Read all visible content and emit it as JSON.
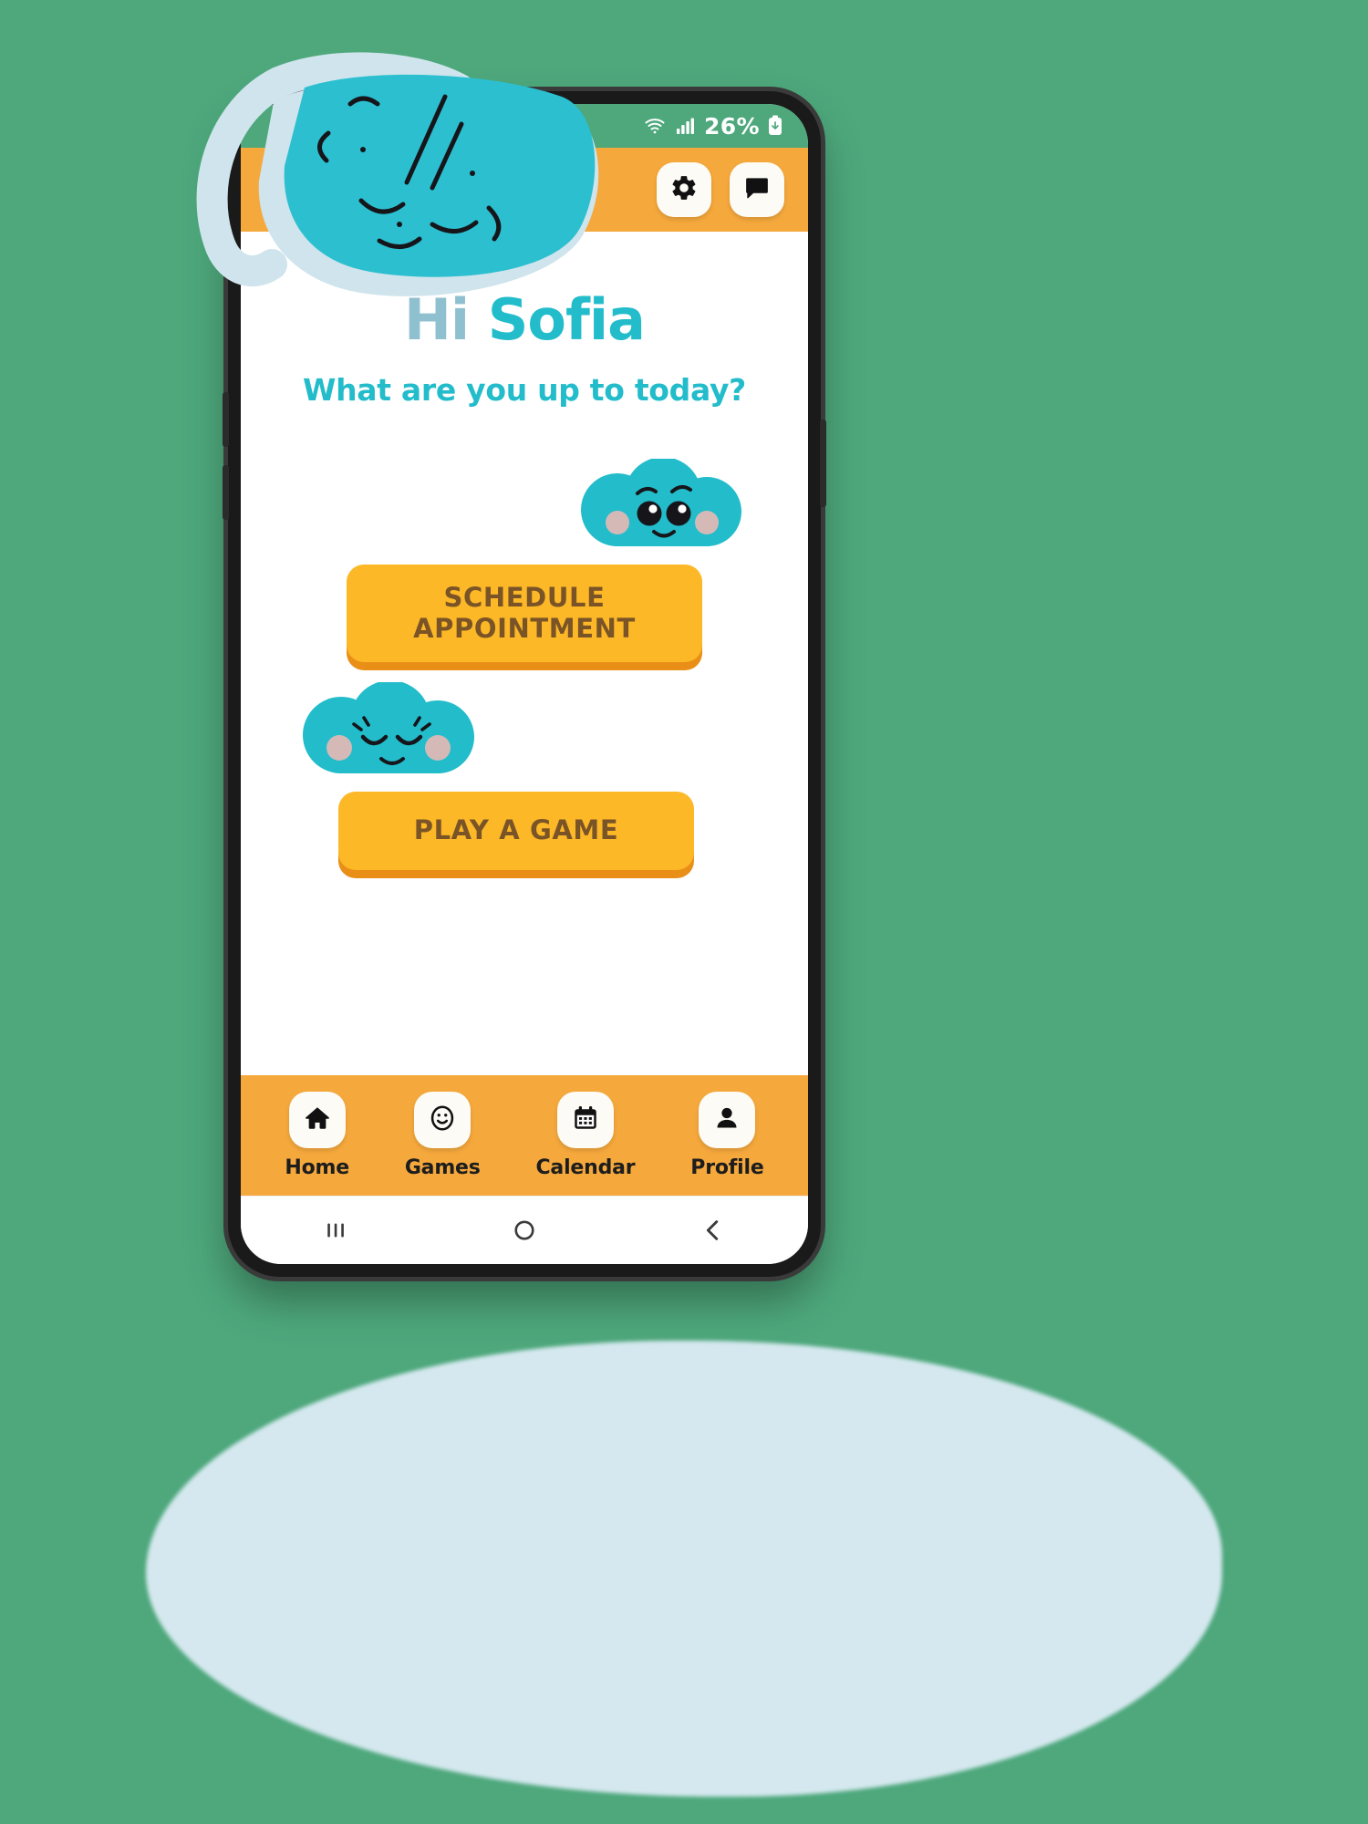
{
  "statusbar": {
    "battery_percent": "26%",
    "icons": [
      "wifi-icon",
      "signal-icon",
      "battery-icon"
    ]
  },
  "header": {
    "settings_icon": "gear-icon",
    "chat_icon": "chat-bubble-icon"
  },
  "main": {
    "greeting_prefix": "Hi",
    "greeting_name": "Sofia",
    "subtitle": "What are you up to today?",
    "schedule_button": "SCHEDULE APPOINTMENT",
    "play_button": "PLAY A GAME",
    "mascot_awake": "cloud-mascot-awake",
    "mascot_sleeping": "cloud-mascot-sleeping"
  },
  "bottom_nav": {
    "items": [
      {
        "label": "Home",
        "icon": "home-icon"
      },
      {
        "label": "Games",
        "icon": "smiley-icon"
      },
      {
        "label": "Calendar",
        "icon": "calendar-icon"
      },
      {
        "label": "Profile",
        "icon": "person-icon"
      }
    ]
  },
  "system_nav": {
    "recents": "recents-icon",
    "home": "home-circle-icon",
    "back": "back-chevron-icon"
  },
  "decoration": {
    "overlay": "vr-headset-doodle"
  },
  "colors": {
    "page_background": "#4ea87c",
    "header_orange": "#f5a83c",
    "button_amber": "#fcb827",
    "button_amber_shadow": "#e98f18",
    "button_text_brown": "#7a5426",
    "accent_cyan": "#22bccb",
    "greeting_muted": "#8fc0cf",
    "shadow_blob": "#d5e8ef"
  }
}
